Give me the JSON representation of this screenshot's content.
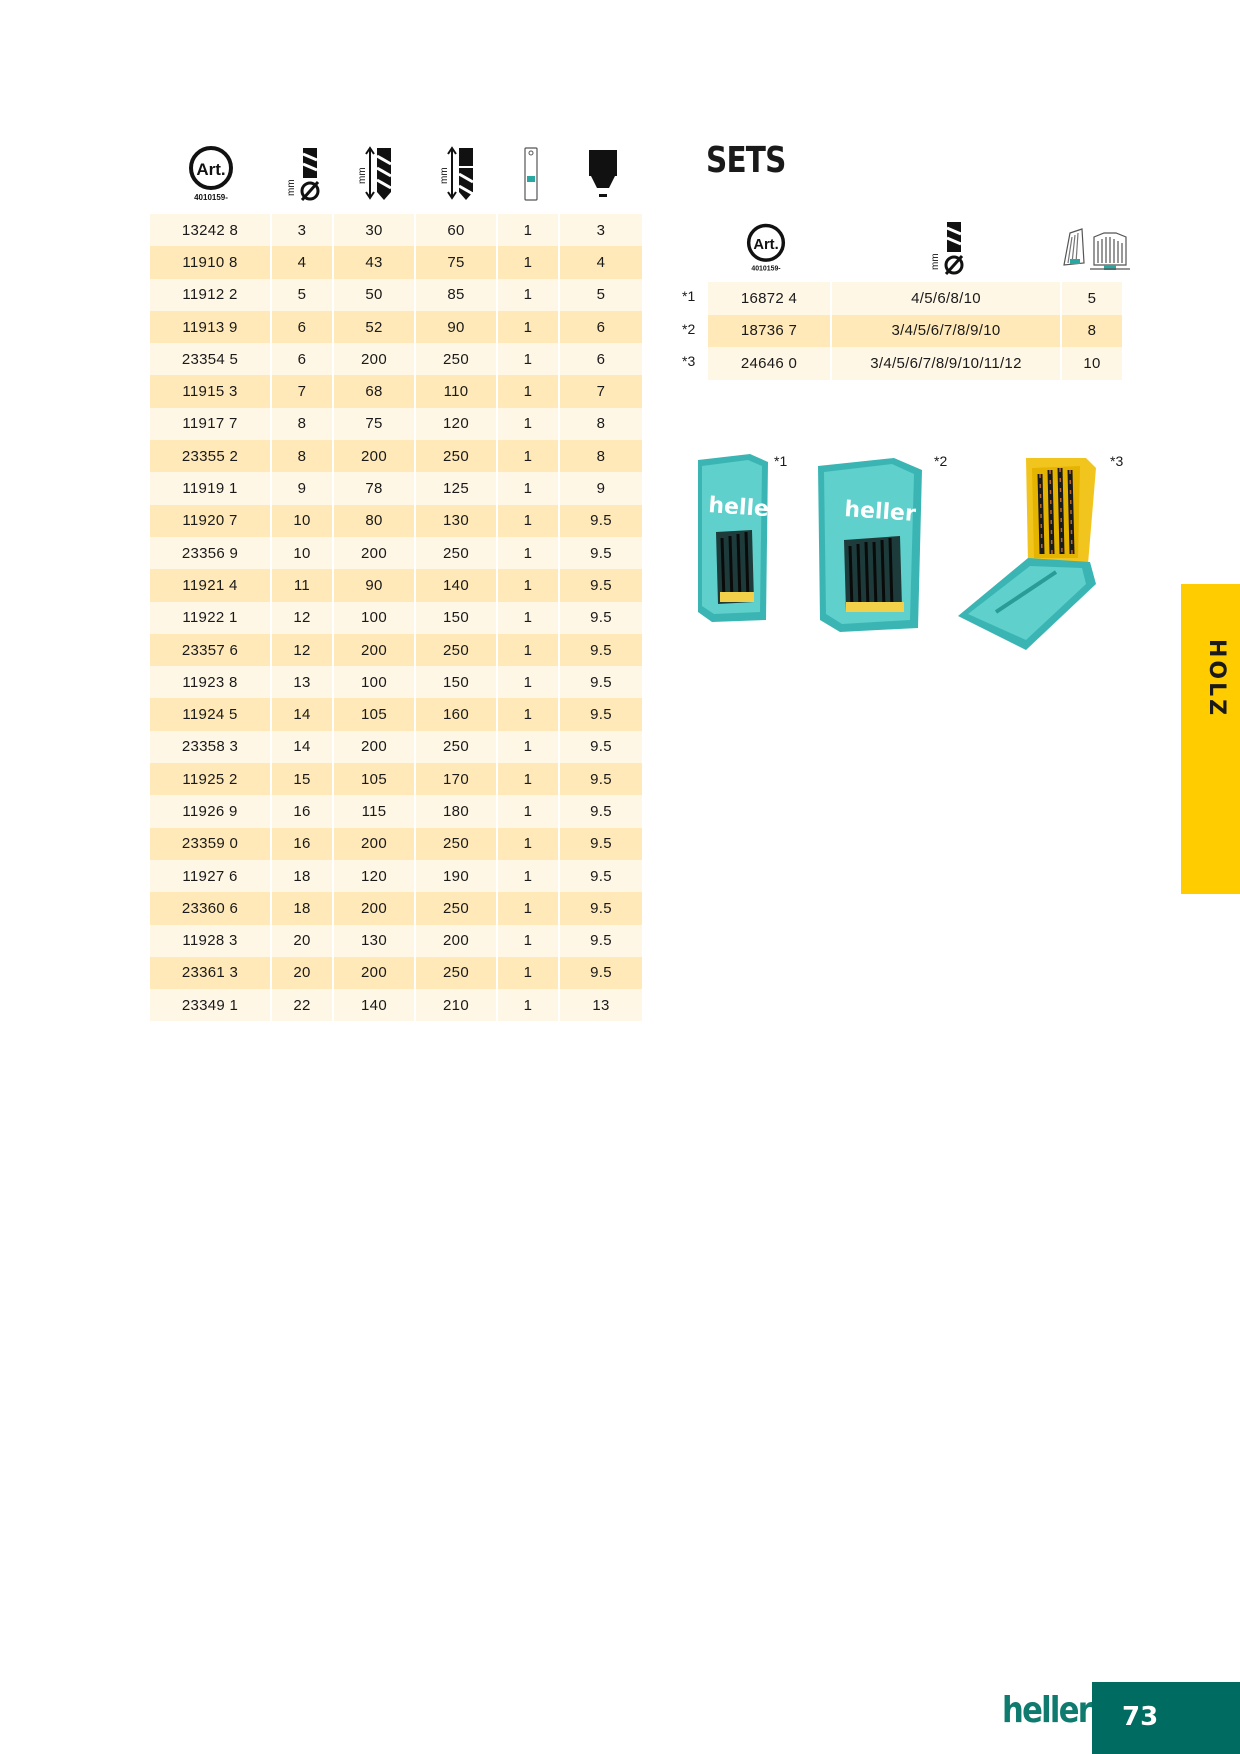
{
  "icons": {
    "article": "article-number-icon",
    "article_label": "Art.",
    "article_prefix": "4010159-",
    "diameter": "drill-diameter-icon",
    "diameter_unit": "mm",
    "working_length": "working-length-icon",
    "total_length": "total-length-icon",
    "pack": "single-pack-icon",
    "chuck": "shank-diameter-icon"
  },
  "main_table": {
    "rows": [
      [
        "13242 8",
        "3",
        "30",
        "60",
        "1",
        "3"
      ],
      [
        "11910 8",
        "4",
        "43",
        "75",
        "1",
        "4"
      ],
      [
        "11912 2",
        "5",
        "50",
        "85",
        "1",
        "5"
      ],
      [
        "11913 9",
        "6",
        "52",
        "90",
        "1",
        "6"
      ],
      [
        "23354 5",
        "6",
        "200",
        "250",
        "1",
        "6"
      ],
      [
        "11915 3",
        "7",
        "68",
        "110",
        "1",
        "7"
      ],
      [
        "11917 7",
        "8",
        "75",
        "120",
        "1",
        "8"
      ],
      [
        "23355 2",
        "8",
        "200",
        "250",
        "1",
        "8"
      ],
      [
        "11919 1",
        "9",
        "78",
        "125",
        "1",
        "9"
      ],
      [
        "11920 7",
        "10",
        "80",
        "130",
        "1",
        "9.5"
      ],
      [
        "23356 9",
        "10",
        "200",
        "250",
        "1",
        "9.5"
      ],
      [
        "11921 4",
        "11",
        "90",
        "140",
        "1",
        "9.5"
      ],
      [
        "11922 1",
        "12",
        "100",
        "150",
        "1",
        "9.5"
      ],
      [
        "23357 6",
        "12",
        "200",
        "250",
        "1",
        "9.5"
      ],
      [
        "11923 8",
        "13",
        "100",
        "150",
        "1",
        "9.5"
      ],
      [
        "11924 5",
        "14",
        "105",
        "160",
        "1",
        "9.5"
      ],
      [
        "23358 3",
        "14",
        "200",
        "250",
        "1",
        "9.5"
      ],
      [
        "11925 2",
        "15",
        "105",
        "170",
        "1",
        "9.5"
      ],
      [
        "11926 9",
        "16",
        "115",
        "180",
        "1",
        "9.5"
      ],
      [
        "23359 0",
        "16",
        "200",
        "250",
        "1",
        "9.5"
      ],
      [
        "11927 6",
        "18",
        "120",
        "190",
        "1",
        "9.5"
      ],
      [
        "23360 6",
        "18",
        "200",
        "250",
        "1",
        "9.5"
      ],
      [
        "11928 3",
        "20",
        "130",
        "200",
        "1",
        "9.5"
      ],
      [
        "23361 3",
        "20",
        "200",
        "250",
        "1",
        "9.5"
      ],
      [
        "23349 1",
        "22",
        "140",
        "210",
        "1",
        "13"
      ]
    ]
  },
  "sets": {
    "title": "SETS",
    "icons": {
      "article": "article-number-icon",
      "diameter": "drill-diameter-icon",
      "cassette": "set-cassette-icon"
    },
    "rows": [
      {
        "marker": "*1",
        "article": "16872 4",
        "sizes": "4/5/6/8/10",
        "count": "5"
      },
      {
        "marker": "*2",
        "article": "18736 7",
        "sizes": "3/4/5/6/7/8/9/10",
        "count": "8"
      },
      {
        "marker": "*3",
        "article": "24646 0",
        "sizes": "3/4/5/6/7/8/9/10/11/12",
        "count": "10"
      }
    ],
    "images": [
      {
        "note": "*1",
        "brand": "heller"
      },
      {
        "note": "*2",
        "brand": "heller"
      },
      {
        "note": "*3"
      }
    ]
  },
  "side_tab": {
    "label": "HOLZ"
  },
  "footer": {
    "brand": "heller",
    "page_number": "73"
  },
  "colors": {
    "row_light": "#fff7e6",
    "row_dark": "#ffe9b8",
    "tab_yellow": "#ffcc00",
    "brand_green": "#006b61"
  }
}
